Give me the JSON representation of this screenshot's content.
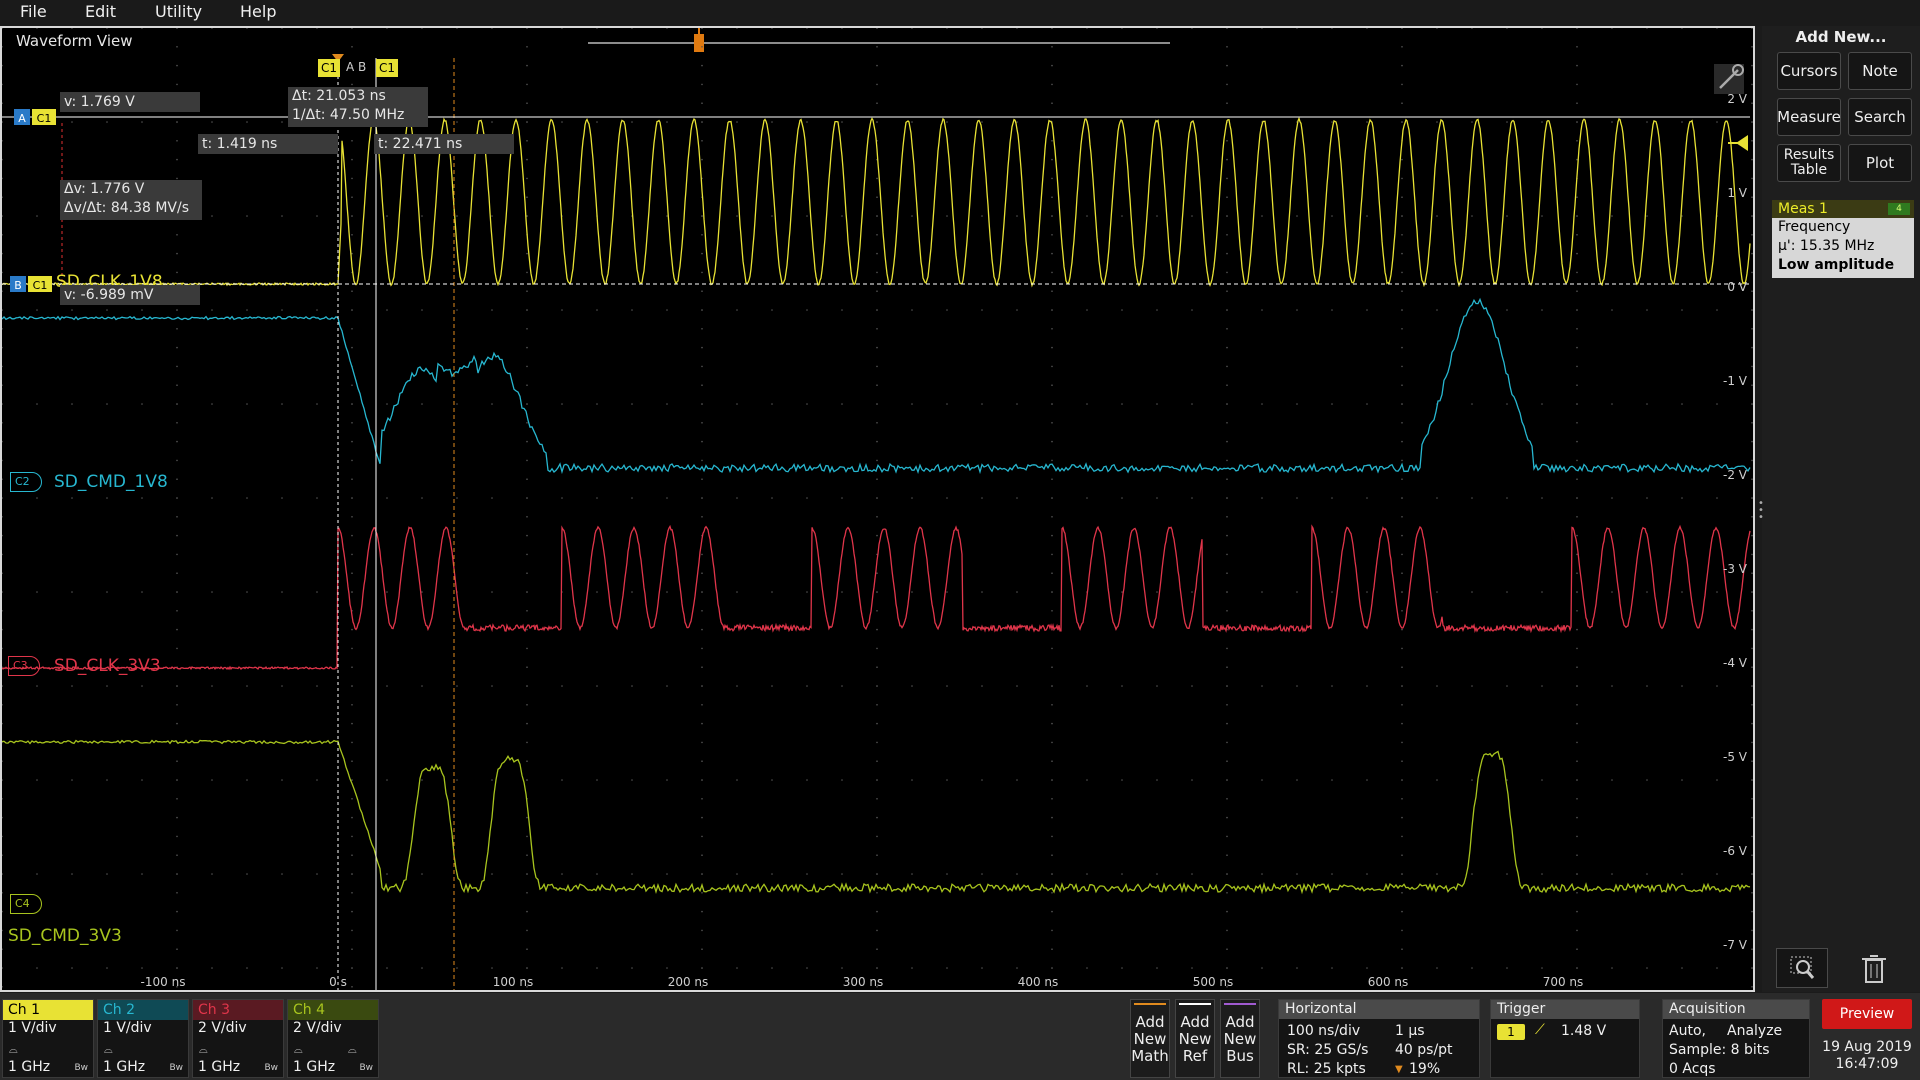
{
  "menu": {
    "items": [
      "File",
      "Edit",
      "Utility",
      "Help"
    ]
  },
  "waveform_view": {
    "title": "Waveform View",
    "time_axis": {
      "ticks": [
        "-100 ns",
        "0 s",
        "100 ns",
        "200 ns",
        "300 ns",
        "400 ns",
        "500 ns",
        "600 ns",
        "700 ns"
      ]
    },
    "voltage_axis": {
      "ticks": [
        "2 V",
        "1 V",
        "0 V",
        "-1 V",
        "-2 V",
        "-3 V",
        "-4 V",
        "-5 V",
        "-6 V",
        "-7 V"
      ]
    },
    "cursor_bar": {
      "left_label": "C1",
      "sep": "A B",
      "right_label": "C1"
    },
    "cursor_readouts": {
      "v_a": "v: 1.769 V",
      "dt": "Δt: 21.053 ns",
      "inv_dt": "1/Δt: 47.50 MHz",
      "t_a": "t: 1.419 ns",
      "t_b": "t: 22.471 ns",
      "dv": "Δv: 1.776 V",
      "dvdt": "Δv/Δt: 84.38 MV/s",
      "v_b": "v: -6.989 mV"
    },
    "cursor_markers": {
      "a": "A",
      "b": "B",
      "a_ch": "C1",
      "b_ch": "C1"
    },
    "channels": [
      {
        "badge": "C1",
        "name": "SD_CLK_1V8",
        "color": "#e8e234"
      },
      {
        "badge": "C2",
        "name": "SD_CMD_1V8",
        "color": "#27b7d0"
      },
      {
        "badge": "C3",
        "name": "SD_CLK_3V3",
        "color": "#e0354a"
      },
      {
        "badge": "C4",
        "name": "SD_CMD_3V3",
        "color": "#a8c41e"
      }
    ]
  },
  "right_panel": {
    "title": "Add New...",
    "buttons": [
      {
        "label": "Cursors"
      },
      {
        "label": "Note"
      },
      {
        "label": "Measure"
      },
      {
        "label": "Search"
      },
      {
        "label": "Results Table"
      },
      {
        "label": "Plot"
      }
    ],
    "meas1": {
      "header": "Meas 1",
      "badge": "4",
      "line1": "Frequency",
      "line2": "μ': 15.35 MHz",
      "line3": "Low amplitude"
    },
    "zoom_icon": "zoom-icon",
    "trash_icon": "trash-icon"
  },
  "bottom": {
    "channels": [
      {
        "label": "Ch 1",
        "scale": "1 V/div",
        "bw": "1 GHz",
        "bw_icon": "Bw",
        "color": "#e8e234"
      },
      {
        "label": "Ch 2",
        "scale": "1 V/div",
        "bw": "1 GHz",
        "bw_icon": "Bw",
        "color": "#27b7d0"
      },
      {
        "label": "Ch 3",
        "scale": "2 V/div",
        "bw": "1 GHz",
        "bw_icon": "Bw",
        "color": "#e0354a"
      },
      {
        "label": "Ch 4",
        "scale": "2 V/div",
        "bw": "1 GHz",
        "bw_icon": "Bw",
        "color": "#a8c41e"
      }
    ],
    "add_buttons": [
      {
        "label1": "Add",
        "label2": "New",
        "label3": "Math",
        "color": "#e08a1e"
      },
      {
        "label1": "Add",
        "label2": "New",
        "label3": "Ref",
        "color": "#ffffff"
      },
      {
        "label1": "Add",
        "label2": "New",
        "label3": "Bus",
        "color": "#a05ad0"
      }
    ],
    "horizontal": {
      "title": "Horizontal",
      "scale": "100 ns/div",
      "duration": "1 μs",
      "sr": "SR: 25 GS/s",
      "res": "40 ps/pt",
      "rl": "RL: 25 kpts",
      "pos": "19%"
    },
    "trigger": {
      "title": "Trigger",
      "source": "1",
      "level": "1.48 V"
    },
    "acquisition": {
      "title": "Acquisition",
      "mode": "Auto,",
      "analyze": "Analyze",
      "sample": "Sample: 8 bits",
      "acqs": "0 Acqs"
    },
    "preview": "Preview",
    "date": "19 Aug 2019",
    "time": "16:47:09"
  }
}
